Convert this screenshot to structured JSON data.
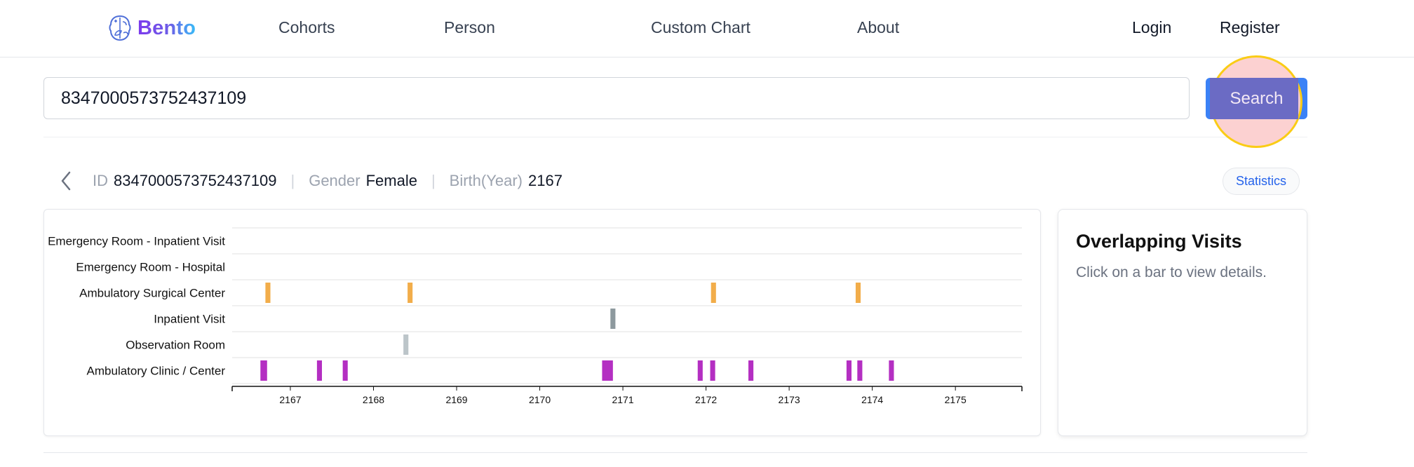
{
  "brand": {
    "name": "Bento",
    "icon": "brain-leaf-icon"
  },
  "nav": {
    "links": [
      "Cohorts",
      "Person",
      "Custom Chart",
      "About"
    ],
    "login": "Login",
    "register": "Register"
  },
  "search": {
    "value": "8347000573752437109",
    "button_label": "Search"
  },
  "person": {
    "id_label": "ID",
    "id_value": "8347000573752437109",
    "gender_label": "Gender",
    "gender_value": "Female",
    "birth_label": "Birth(Year)",
    "birth_value": "2167",
    "statistics_label": "Statistics"
  },
  "chart_data": {
    "type": "timeline",
    "title": "",
    "xlabel": "",
    "ylabel": "",
    "xlim": [
      2166.3,
      2175.8
    ],
    "x_ticks": [
      "2167",
      "2168",
      "2169",
      "2170",
      "2171",
      "2172",
      "2173",
      "2174",
      "2175"
    ],
    "rows": [
      "Emergency Room - Inpatient Visit",
      "Emergency Room - Hospital",
      "Ambulatory Surgical Center",
      "Inpatient Visit",
      "Observation Room",
      "Ambulatory Clinic / Center"
    ],
    "row_colors": [
      "#f0a030",
      "#f0a030",
      "#f2ad4a",
      "#8d999e",
      "#bcc5c9",
      "#b42fc2"
    ],
    "events": [
      {
        "row": 2,
        "start": 2166.7,
        "end": 2166.76
      },
      {
        "row": 2,
        "start": 2168.41,
        "end": 2168.47
      },
      {
        "row": 2,
        "start": 2172.06,
        "end": 2172.12
      },
      {
        "row": 2,
        "start": 2173.8,
        "end": 2173.86
      },
      {
        "row": 3,
        "start": 2170.85,
        "end": 2170.91
      },
      {
        "row": 4,
        "start": 2168.36,
        "end": 2168.42
      },
      {
        "row": 5,
        "start": 2166.64,
        "end": 2166.72
      },
      {
        "row": 5,
        "start": 2167.32,
        "end": 2167.38
      },
      {
        "row": 5,
        "start": 2167.63,
        "end": 2167.69
      },
      {
        "row": 5,
        "start": 2170.75,
        "end": 2170.88
      },
      {
        "row": 5,
        "start": 2171.9,
        "end": 2171.96
      },
      {
        "row": 5,
        "start": 2172.05,
        "end": 2172.11
      },
      {
        "row": 5,
        "start": 2172.51,
        "end": 2172.57
      },
      {
        "row": 5,
        "start": 2173.69,
        "end": 2173.75
      },
      {
        "row": 5,
        "start": 2173.82,
        "end": 2173.88
      },
      {
        "row": 5,
        "start": 2174.2,
        "end": 2174.26
      }
    ]
  },
  "details": {
    "title": "Overlapping Visits",
    "hint": "Click on a bar to view details."
  }
}
